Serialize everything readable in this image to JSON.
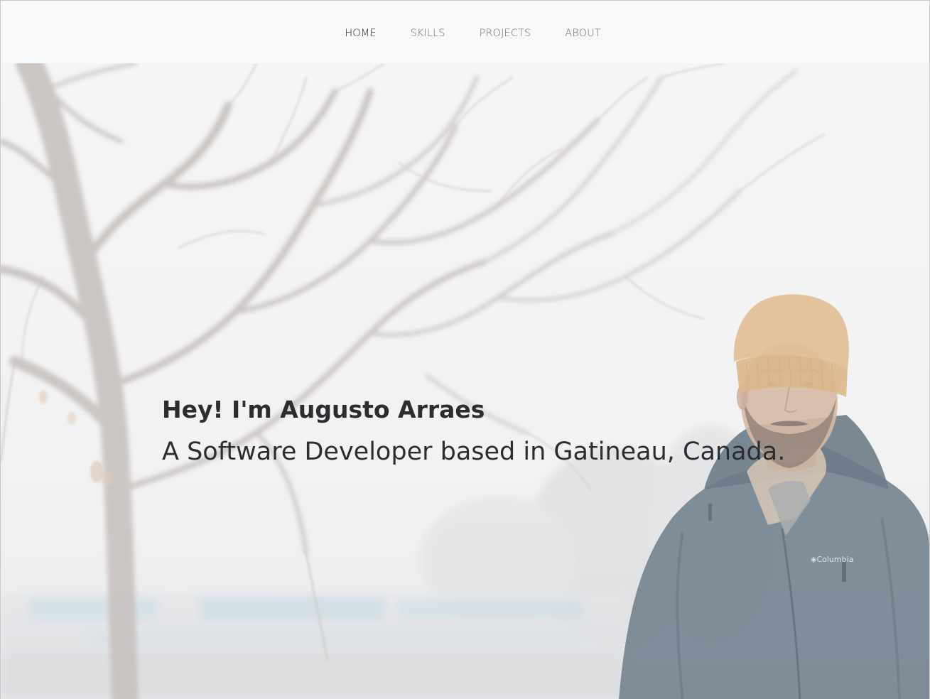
{
  "nav": {
    "items": [
      {
        "label": "HOME",
        "active": true
      },
      {
        "label": "SKILLS",
        "active": false
      },
      {
        "label": "PROJECTS",
        "active": false
      },
      {
        "label": "ABOUT",
        "active": false
      }
    ]
  },
  "hero": {
    "greeting": "Hey! I'm Augusto Arraes",
    "tagline": "A Software Developer based in Gatineau, Canada.",
    "jacket_brand": "Columbia"
  },
  "colors": {
    "nav_bg": "#f8f9fa",
    "nav_text": "#6c6c6c",
    "nav_active_text": "#262626",
    "hero_text": "#2b2d31",
    "beanie": "#d6a66e",
    "jacket": "#34495a"
  }
}
